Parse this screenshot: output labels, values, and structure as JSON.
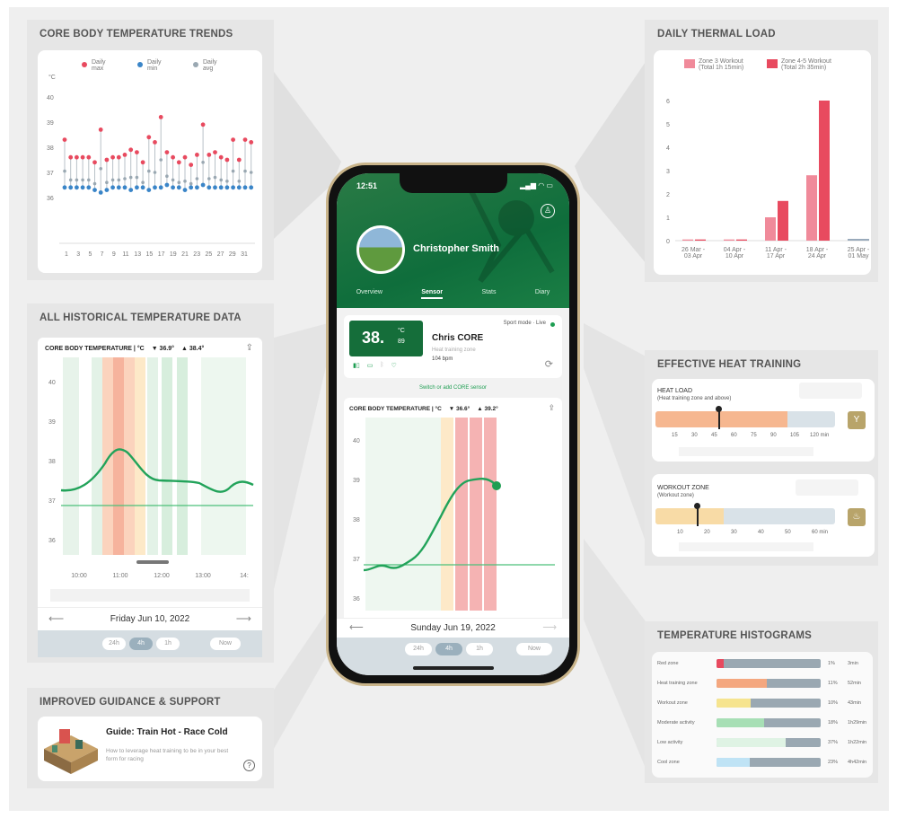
{
  "colors": {
    "green": "#1e9e52",
    "red": "#e84a5f",
    "pink": "#f08a9a",
    "blue": "#3a85c8",
    "gray": "#9aa8b2"
  },
  "panels": {
    "trends": {
      "title": "CORE BODY TEMPERATURE TRENDS",
      "legend": [
        {
          "label": "Daily max",
          "color": "#e84a5f"
        },
        {
          "label": "Daily min",
          "color": "#3a85c8"
        },
        {
          "label": "Daily avg",
          "color": "#9aa8b2"
        }
      ],
      "unit": "°C",
      "y_ticks": [
        "40",
        "39",
        "38",
        "37",
        "36"
      ],
      "x_ticks": [
        "1",
        "3",
        "5",
        "7",
        "9",
        "11",
        "13",
        "15",
        "17",
        "19",
        "21",
        "23",
        "25",
        "27",
        "29",
        "31"
      ]
    },
    "historical": {
      "title": "ALL HISTORICAL TEMPERATURE DATA",
      "card_title": "CORE BODY TEMPERATURE | °C",
      "min": "▼ 36.9°",
      "max": "▲ 38.4°",
      "y_ticks": [
        "40",
        "39",
        "38",
        "37",
        "36"
      ],
      "x_ticks": [
        "10:00",
        "11:00",
        "12:00",
        "13:00",
        "14:"
      ],
      "date": "Friday Jun 10, 2022",
      "ranges": [
        "24h",
        "4h",
        "1h"
      ],
      "now": "Now"
    },
    "guidance": {
      "title": "IMPROVED GUIDANCE & SUPPORT",
      "card_title": "Guide: Train Hot - Race Cold",
      "card_text": "How to leverage heat training to be in your best form for racing"
    },
    "thermal": {
      "title": "DAILY THERMAL LOAD",
      "legend": [
        "Zone 3 Workout (Total 1h 15min)",
        "Zone 4-5 Workout (Total 2h 35min)"
      ],
      "y_ticks": [
        "0",
        "1",
        "2",
        "3",
        "4",
        "5",
        "6"
      ],
      "x_ticks": [
        "26 Mar - 03 Apr",
        "04 Apr - 10 Apr",
        "11 Apr - 17 Apr",
        "18 Apr - 24 Apr",
        "25 Apr - 01 May"
      ]
    },
    "heat": {
      "title": "EFFECTIVE HEAT TRAINING",
      "load_label": "HEAT LOAD",
      "load_sub": "(Heat training zone and above)",
      "load_ticks": [
        "15",
        "30",
        "45",
        "60",
        "75",
        "90",
        "105",
        "120 min"
      ],
      "zone_label": "WORKOUT ZONE",
      "zone_sub": "(Workout zone)",
      "zone_ticks": [
        "10",
        "20",
        "30",
        "40",
        "50",
        "60 min"
      ]
    },
    "hist": {
      "title": "TEMPERATURE HISTOGRAMS",
      "rows": [
        {
          "label": "Red zone",
          "pct": "1%",
          "time": "3min",
          "color": "#e84a5f",
          "fill": 0.07
        },
        {
          "label": "Heat training zone",
          "pct": "11%",
          "time": "52min",
          "color": "#f4a77f",
          "fill": 0.48
        },
        {
          "label": "Workout zone",
          "pct": "10%",
          "time": "43min",
          "color": "#f6e48f",
          "fill": 0.33
        },
        {
          "label": "Moderate activity",
          "pct": "18%",
          "time": "1h29min",
          "color": "#a7dfb5",
          "fill": 0.46
        },
        {
          "label": "Low activity",
          "pct": "37%",
          "time": "1h22min",
          "color": "#dff3e4",
          "fill": 0.66
        },
        {
          "label": "Cool zone",
          "pct": "23%",
          "time": "4h42min",
          "color": "#bfe3f5",
          "fill": 0.32
        }
      ]
    }
  },
  "phone": {
    "time": "12:51",
    "user": "Christopher Smith",
    "tabs": [
      "Overview",
      "Sensor",
      "Stats",
      "Diary"
    ],
    "temp": "38.",
    "temp_dec": "89",
    "temp_unit": "°C",
    "mode": "Sport mode · Live",
    "device": "Chris CORE",
    "zone": "Heat training zone",
    "hr": "104 bpm",
    "switch": "Switch or add CORE sensor",
    "card_title": "CORE BODY TEMPERATURE | °C",
    "min": "▼ 36.6°",
    "max": "▲ 39.2°",
    "y_ticks": [
      "40",
      "39",
      "38",
      "37",
      "36"
    ],
    "date": "Sunday Jun 19, 2022",
    "ranges": [
      "24h",
      "4h",
      "1h"
    ],
    "now": "Now"
  }
}
